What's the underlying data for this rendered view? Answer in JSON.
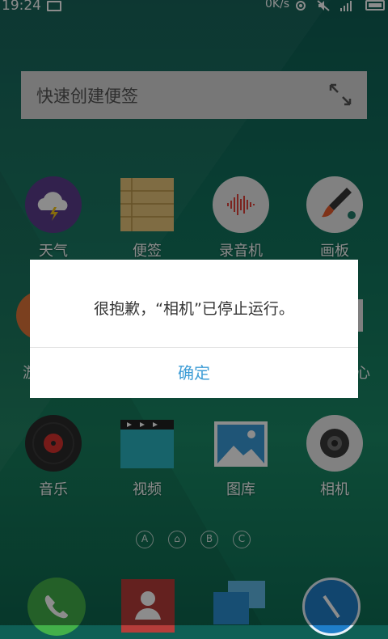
{
  "status_bar": {
    "time": "19:24",
    "network_speed": "0K/s",
    "icons": [
      "image-icon",
      "sync-icon",
      "mute-icon",
      "signal-icon",
      "battery-icon"
    ]
  },
  "note_widget": {
    "placeholder": "快速创建便签",
    "expand_icon": "expand-arrows-icon"
  },
  "apps_row1": [
    {
      "label": "天气",
      "icon": "weather-icon"
    },
    {
      "label": "便签",
      "icon": "notepad-icon"
    },
    {
      "label": "录音机",
      "icon": "recorder-icon"
    },
    {
      "label": "画板",
      "icon": "paint-icon"
    }
  ],
  "apps_row2_partial": {
    "left": "游",
    "right": "心"
  },
  "apps_row3": [
    {
      "label": "音乐",
      "icon": "music-icon"
    },
    {
      "label": "视频",
      "icon": "video-icon"
    },
    {
      "label": "图库",
      "icon": "gallery-icon"
    },
    {
      "label": "相机",
      "icon": "camera-icon"
    }
  ],
  "page_indicators": [
    "A",
    "⌂",
    "B",
    "C"
  ],
  "dock": [
    "phone-icon",
    "contacts-icon",
    "messages-icon",
    "browser-icon"
  ],
  "dialog": {
    "message": "很抱歉，“相机”已停止运行。",
    "button": "确定"
  },
  "colors": {
    "dialog_button": "#3e9dd6",
    "background": "#13785f"
  }
}
